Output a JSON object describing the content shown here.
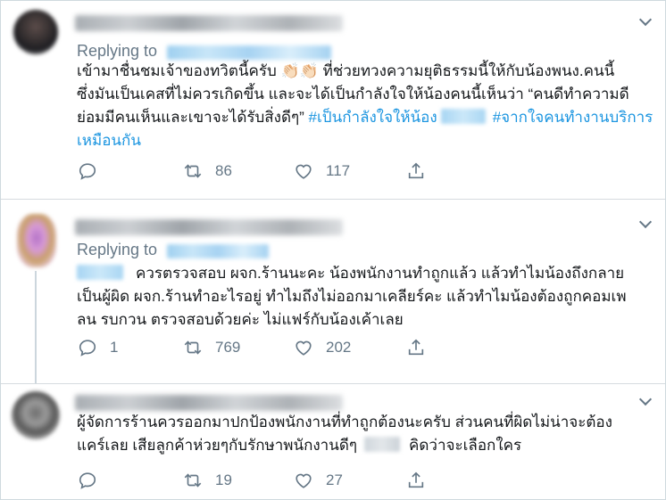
{
  "tweets": [
    {
      "replying_label": "Replying to",
      "body_1": "เข้ามาชื่นชมเจ้าของทวิตนี้ครับ 👏🏻👏🏻 ที่ช่วยทวงความยุติธรรมนี้ให้กับน้องพนง.คนนี้",
      "body_2": "ซึ่งมันเป็นเคสที่ไม่ควรเกิดขึ้น และจะได้เป็นกำลังใจให้น้องคนนี้เห็นว่า “คนดีทำความดี",
      "body_3": "ย่อมมีคนเห็นและเขาจะได้รับสิ่งดีๆ” ",
      "hashtag_1": "#เป็นกำลังใจให้น้อง",
      "hashtag_2": "#จากใจคนทำงานบริการ",
      "hashtag_2_cont": "เหมือนกัน",
      "reply_count": "",
      "retweet_count": "86",
      "like_count": "117"
    },
    {
      "replying_label": "Replying to",
      "body_1": "ควรตรวจสอบ ผจก.ร้านนะคะ น้องพนักงานทำถูกแล้ว แล้วทำไมน้องถึงกลาย",
      "body_2": "เป็นผู้ผิด ผจก.ร้านทำอะไรอยู่ ทำไมถึงไม่ออกมาเคลียร์คะ แล้วทำไมน้องต้องถูกคอมเพ",
      "body_3": "ลน รบกวน ตรวจสอบด้วยค่ะ ไม่แฟร์กับน้องเค้าเลย",
      "reply_count": "1",
      "retweet_count": "769",
      "like_count": "202"
    },
    {
      "body_1": "ผู้จัดการร้านควรออกมาปกป้องพนักงานที่ทำถูกต้องนะครับ ส่วนคนที่ผิดไม่น่าจะต้อง",
      "body_2a": "แคร์เลย เสียลูกค้าห่วยๆกับรักษาพนักงานดีๆ",
      "body_2b": "คิดว่าจะเลือกใคร",
      "reply_count": "",
      "retweet_count": "19",
      "like_count": "27"
    }
  ],
  "icons": {
    "reply": "reply-icon",
    "retweet": "retweet-icon",
    "like": "heart-icon",
    "share": "share-icon",
    "more": "chevron-down-icon"
  },
  "colors": {
    "link": "#1b95e0",
    "secondary_text": "#657786",
    "divider": "#d6dbdf"
  }
}
